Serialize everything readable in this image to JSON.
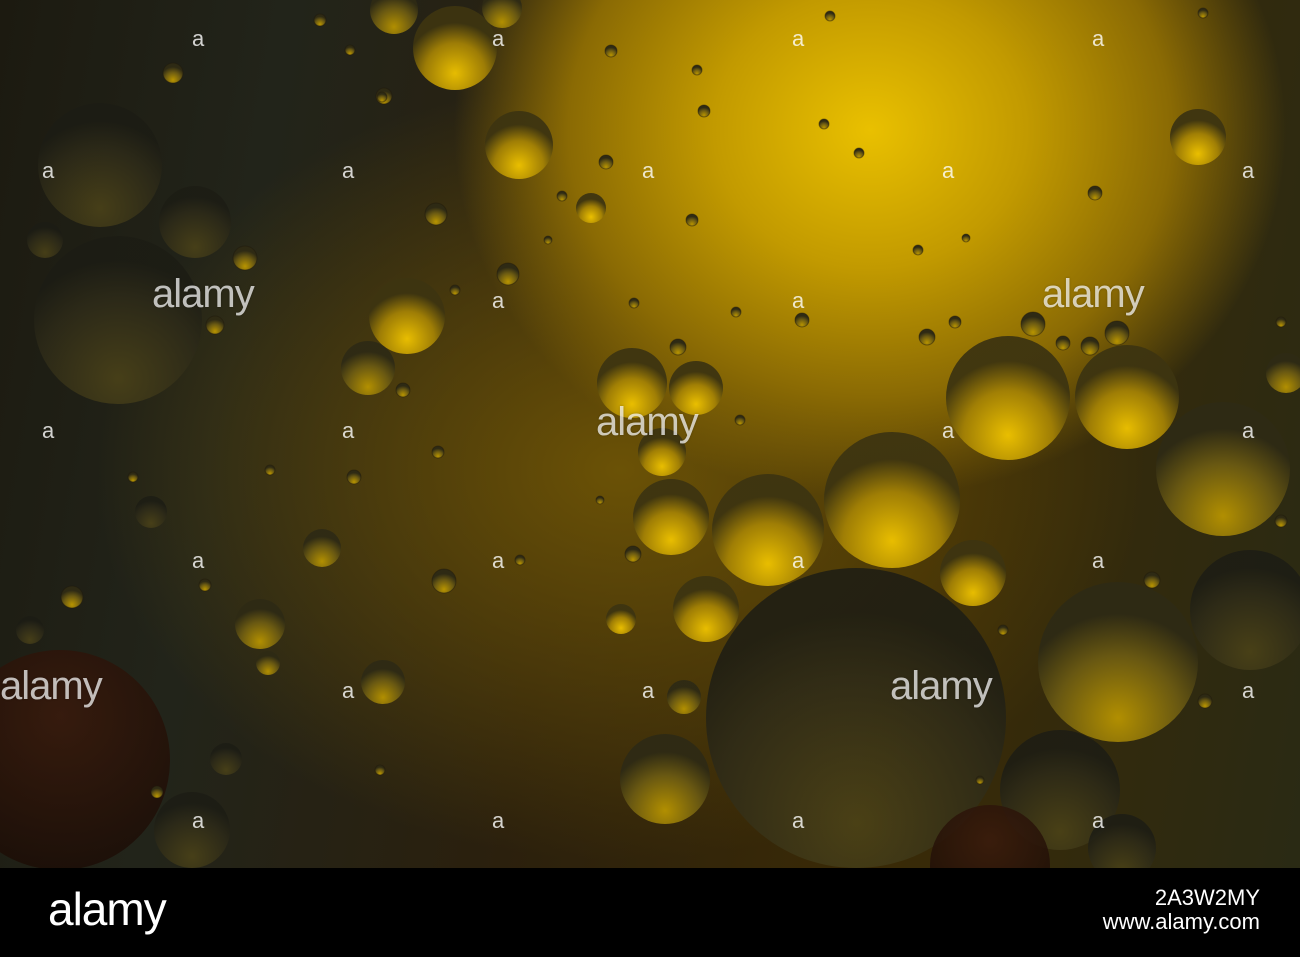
{
  "watermark": {
    "brand": "alamy",
    "diagonal_mark": "a"
  },
  "footer": {
    "logo": "alamy",
    "image_id": "2A3W2MY",
    "site": "www.alamy.com"
  },
  "colors": {
    "glow": "#e9c000",
    "bubble_highlight": "#f0c400",
    "bubble_shadow": "#2a2410",
    "background_dark": "#1c1a10"
  }
}
